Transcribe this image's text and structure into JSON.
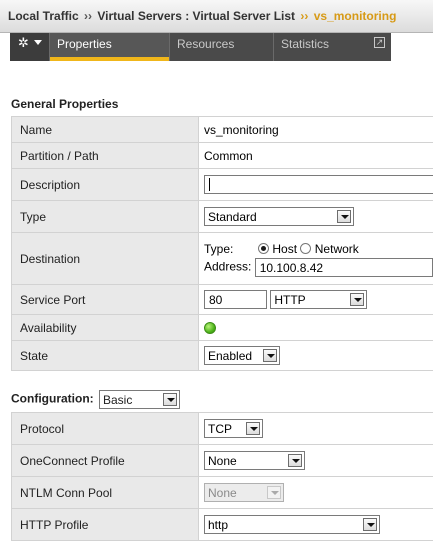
{
  "breadcrumb": {
    "items": [
      "Local Traffic",
      "Virtual Servers : Virtual Server List"
    ],
    "separator": "››",
    "current": "vs_monitoring"
  },
  "tabs": {
    "gear_icon": "gear-icon",
    "items": [
      "Properties",
      "Resources",
      "Statistics"
    ],
    "active": "Properties",
    "popout_icon": "↗"
  },
  "general": {
    "title": "General Properties",
    "name_label": "Name",
    "name_value": "vs_monitoring",
    "partition_label": "Partition / Path",
    "partition_value": "Common",
    "description_label": "Description",
    "description_value": "",
    "type_label": "Type",
    "type_value": "Standard",
    "destination_label": "Destination",
    "dest_type_label": "Type:",
    "dest_host_label": "Host",
    "dest_network_label": "Network",
    "dest_selected": "Host",
    "address_label": "Address:",
    "address_value": "10.100.8.42",
    "service_port_label": "Service Port",
    "service_port_value": "80",
    "service_port_protocol": "HTTP",
    "availability_label": "Availability",
    "availability_status": "available",
    "availability_color": "#4fb51b",
    "state_label": "State",
    "state_value": "Enabled"
  },
  "configuration": {
    "title": "Configuration:",
    "mode_value": "Basic",
    "protocol_label": "Protocol",
    "protocol_value": "TCP",
    "oneconnect_label": "OneConnect Profile",
    "oneconnect_value": "None",
    "ntlm_label": "NTLM Conn Pool",
    "ntlm_value": "None",
    "http_profile_label": "HTTP Profile",
    "http_profile_value": "http"
  },
  "colors": {
    "accent": "#f0b61a",
    "breadcrumb_current": "#d79a16",
    "tabbar_bg": "#4a4a4a"
  }
}
